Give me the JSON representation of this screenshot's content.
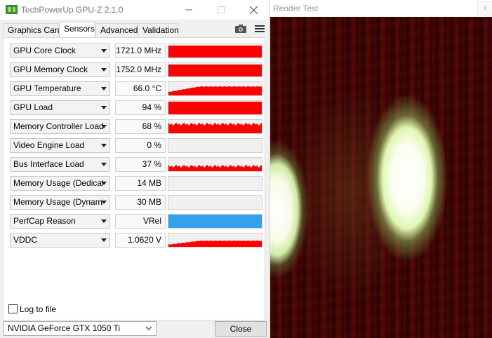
{
  "window": {
    "title": "TechPowerUp GPU-Z 2.1.0",
    "icons": [
      "gpu-chip-icon",
      "minimize-icon",
      "maximize-icon",
      "close-icon"
    ]
  },
  "tabs": [
    {
      "label": "Graphics Card",
      "active": false
    },
    {
      "label": "Sensors",
      "active": true
    },
    {
      "label": "Advanced",
      "active": false
    },
    {
      "label": "Validation",
      "active": false
    }
  ],
  "toolbar": {
    "icons": [
      "camera-icon",
      "menu-icon"
    ]
  },
  "sensors": [
    {
      "name": "GPU Core Clock",
      "value": "1721.0 MHz",
      "graph": "solid",
      "level": 0.9
    },
    {
      "name": "GPU Memory Clock",
      "value": "1752.0 MHz",
      "graph": "solid",
      "level": 0.9
    },
    {
      "name": "GPU Temperature",
      "value": "66.0 °C",
      "graph": "ramp",
      "level": 0.66
    },
    {
      "name": "GPU Load",
      "value": "94 %",
      "graph": "solid",
      "level": 0.94
    },
    {
      "name": "Memory Controller Load",
      "value": "68 %",
      "graph": "noisy",
      "level": 0.68
    },
    {
      "name": "Video Engine Load",
      "value": "0 %",
      "graph": "empty",
      "level": 0
    },
    {
      "name": "Bus Interface Load",
      "value": "37 %",
      "graph": "noisy",
      "level": 0.37
    },
    {
      "name": "Memory Usage (Dedicated)",
      "value": "14 MB",
      "graph": "empty",
      "level": 0.01
    },
    {
      "name": "Memory Usage (Dynamic)",
      "value": "30 MB",
      "graph": "empty",
      "level": 0.01
    },
    {
      "name": "PerfCap Reason",
      "value": "VRel",
      "graph": "perfcap",
      "level": 1
    },
    {
      "name": "VDDC",
      "value": "1.0620 V",
      "graph": "ramp",
      "level": 0.45
    }
  ],
  "colors": {
    "graph_fill": "#ff0000",
    "perfcap_fill": "#33a1ee",
    "window_bg": "#f0f0f0"
  },
  "footer": {
    "log_to_file_label": "Log to file",
    "log_to_file_checked": false,
    "gpu_select_value": "NVIDIA GeForce GTX 1050 Ti",
    "close_label": "Close"
  },
  "render_window": {
    "title": "Render Test",
    "close_glyph": "x"
  }
}
